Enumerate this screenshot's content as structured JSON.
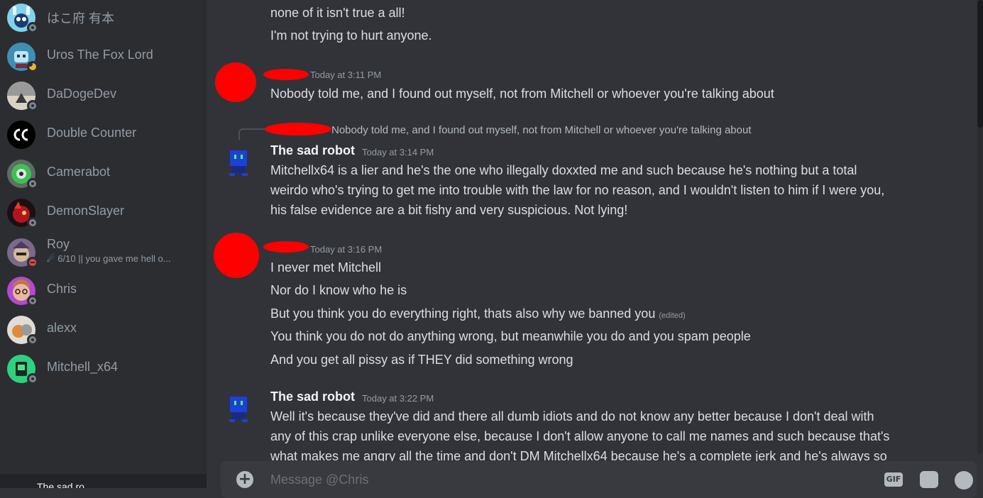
{
  "sidebar": {
    "dms": [
      {
        "name": "はこ府 有本",
        "status": "offline"
      },
      {
        "name": "Uros The Fox Lord",
        "status": "idle"
      },
      {
        "name": "DaDogeDev",
        "status": "offline"
      },
      {
        "name": "Double Counter",
        "status": "none"
      },
      {
        "name": "Camerabot",
        "status": "offline"
      },
      {
        "name": "DemonSlayer",
        "status": "offline"
      },
      {
        "name": "Roy",
        "sub": "6/10 || you gave me hell o...",
        "status": "dnd"
      },
      {
        "name": "Chris",
        "status": "offline"
      },
      {
        "name": "alexx",
        "status": "offline"
      },
      {
        "name": "Mitchell_x64",
        "status": "offline"
      }
    ],
    "footer_user": "The sad ro"
  },
  "messages": {
    "m0_line1": "none of it isn't true a all!",
    "m0_line2": "I'm not trying to hurt anyone.",
    "m1_timestamp": "Today at 3:11 PM",
    "m1_text": "Nobody told me, and I found out myself, not from Mitchell or whoever you're talking about",
    "m2_reply": "Nobody told me, and I found out myself, not from Mitchell or whoever you're talking about",
    "m2_author": "The sad robot",
    "m2_timestamp": "Today at 3:14 PM",
    "m2_line1": "Mitchellx64 is a lier and he's the one who illegally doxxted me and such because he's nothing but a total",
    "m2_line2": "weirdo who's trying to get me into trouble with the law for no reason, and I wouldn't listen to him if I were you,",
    "m2_line3": "his false evidence are a bit fishy and very suspicious. Not lying!",
    "m3_timestamp": "Today at 3:16 PM",
    "m3_line1": "I never met Mitchell",
    "m3_line2": "Nor do I know who he is",
    "m3_line3": "But you think you do everything right, thats also why we banned you",
    "m3_edited": "(edited)",
    "m3_line4": "You think you do not do anything wrong, but meanwhile you do and you spam people",
    "m3_line5": "And you get all pissy as if THEY did something wrong",
    "m4_author": "The sad robot",
    "m4_timestamp": "Today at 3:22 PM",
    "m4_line1": "Well it's because they've did and there all dumb idiots and do not know any better because I don't deal with",
    "m4_line2": "any of this crap unlike everyone else, because I don't allow anyone to call me names and such because that's",
    "m4_line3": "what makes me angry all the time and don't DM Mitchellx64 because he's a complete jerk and he's always so"
  },
  "composer": {
    "placeholder": "Message @Chris",
    "gif_label": "GIF"
  }
}
